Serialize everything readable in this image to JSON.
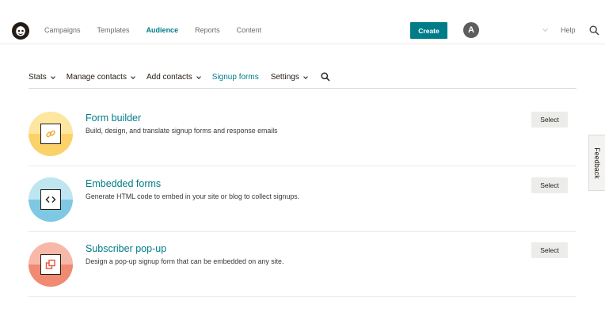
{
  "topnav": {
    "logo_icon": "freddie-logo-icon",
    "links": [
      {
        "label": "Campaigns",
        "active": false
      },
      {
        "label": "Templates",
        "active": false
      },
      {
        "label": "Audience",
        "active": true
      },
      {
        "label": "Reports",
        "active": false
      },
      {
        "label": "Content",
        "active": false
      }
    ],
    "create_label": "Create",
    "avatar_initial": "A",
    "help_label": "Help",
    "search_icon": "search-icon"
  },
  "subnav": {
    "items": [
      {
        "label": "Stats",
        "dropdown": true,
        "active": false
      },
      {
        "label": "Manage contacts",
        "dropdown": true,
        "active": false
      },
      {
        "label": "Add contacts",
        "dropdown": true,
        "active": false
      },
      {
        "label": "Signup forms",
        "dropdown": false,
        "active": true
      },
      {
        "label": "Settings",
        "dropdown": true,
        "active": false
      }
    ],
    "search_icon": "search-icon"
  },
  "forms": [
    {
      "title": "Form builder",
      "description": "Build, design, and translate signup forms and response emails",
      "button": "Select",
      "icon": "link-icon",
      "circle_top": "#fde6a0",
      "circle_bottom": "#fbd26a"
    },
    {
      "title": "Embedded forms",
      "description": "Generate HTML code to embed in your site or blog to collect signups.",
      "button": "Select",
      "icon": "code-icon",
      "circle_top": "#bfe5f0",
      "circle_bottom": "#7ec8e3"
    },
    {
      "title": "Subscriber pop-up",
      "description": "Design a pop-up signup form that can be embedded on any site.",
      "button": "Select",
      "icon": "popup-icon",
      "circle_top": "#f7b8a8",
      "circle_bottom": "#f08a72"
    }
  ],
  "feedback_label": "Feedback",
  "colors": {
    "accent": "#007c89",
    "text": "#241c15",
    "button_bg": "#ececea"
  }
}
